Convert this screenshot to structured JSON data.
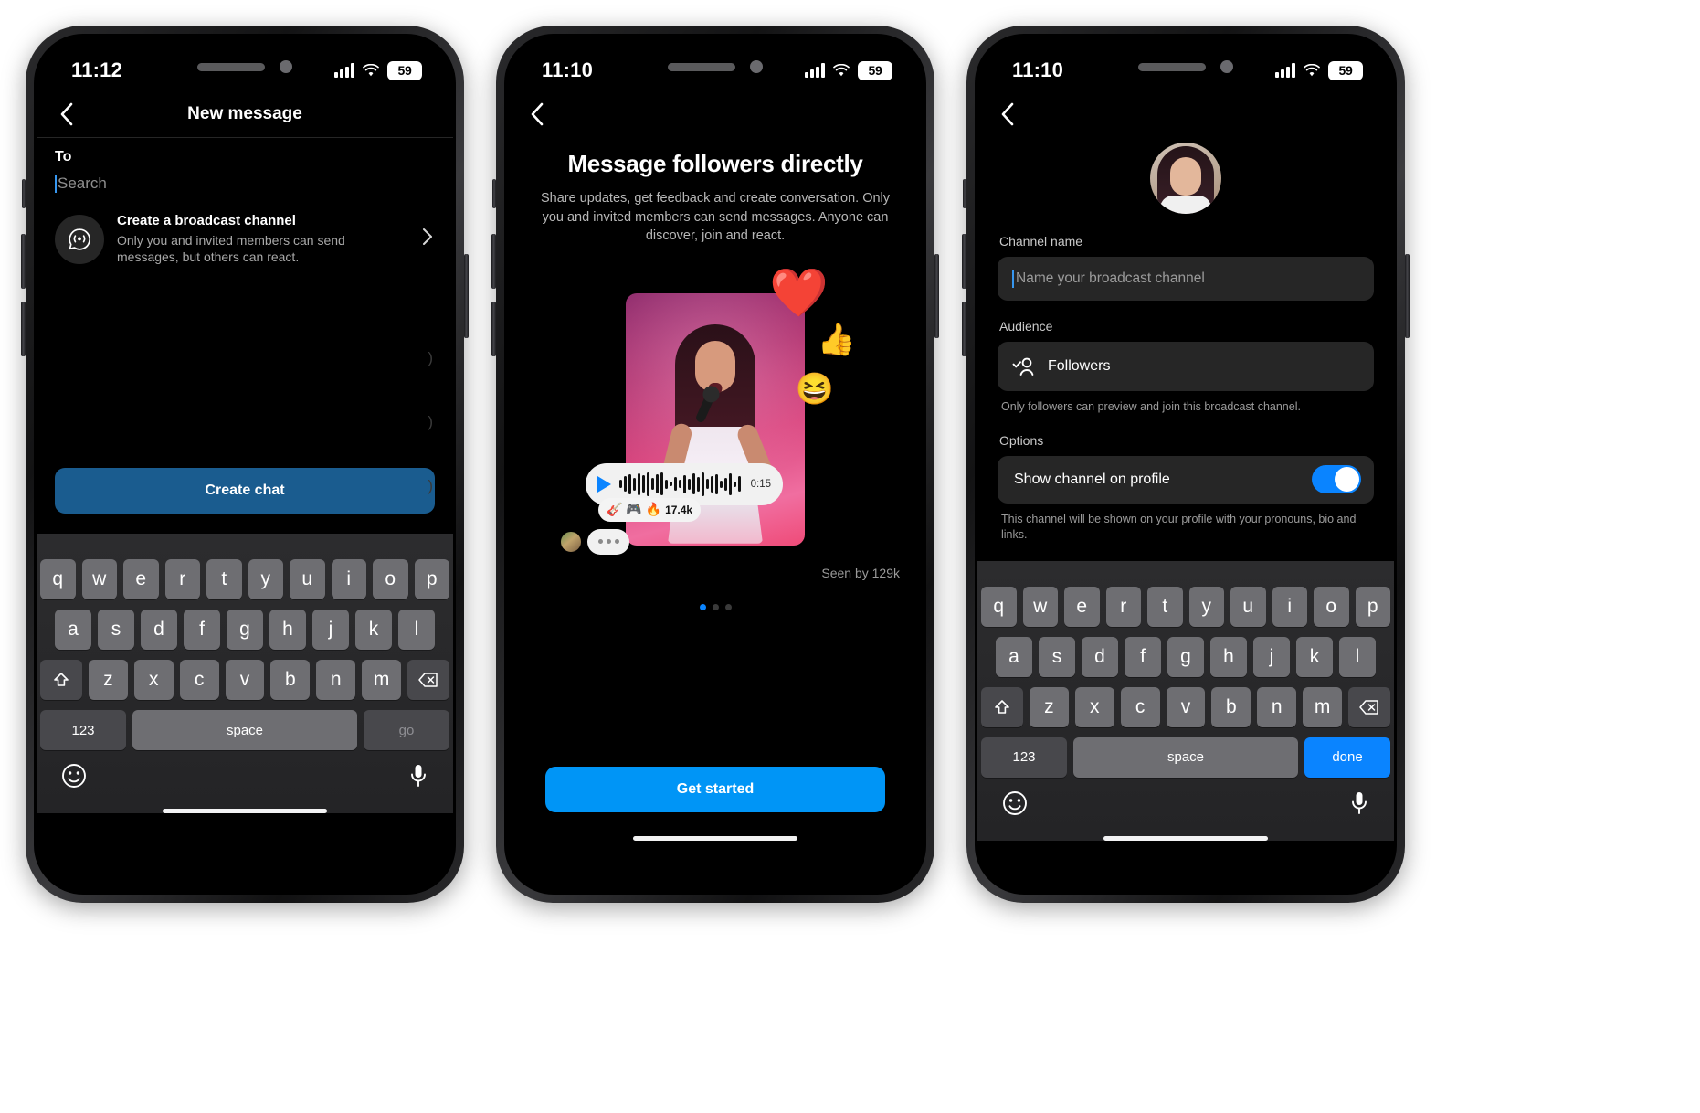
{
  "phones": [
    {
      "id": "new-message",
      "status": {
        "time": "11:12",
        "battery": "59"
      },
      "nav": {
        "title": "New message"
      },
      "to_label": "To",
      "search_placeholder": "Search",
      "broadcast": {
        "title": "Create a broadcast channel",
        "subtitle": "Only you and invited members can send messages, but others can react."
      },
      "cta": "Create chat",
      "keyboard": {
        "row1": [
          "q",
          "w",
          "e",
          "r",
          "t",
          "y",
          "u",
          "i",
          "o",
          "p"
        ],
        "row2": [
          "a",
          "s",
          "d",
          "f",
          "g",
          "h",
          "j",
          "k",
          "l"
        ],
        "row3": [
          "z",
          "x",
          "c",
          "v",
          "b",
          "n",
          "m"
        ],
        "num": "123",
        "space": "space",
        "action": "go"
      }
    },
    {
      "id": "message-followers-directly",
      "status": {
        "time": "11:10",
        "battery": "59"
      },
      "title": "Message followers directly",
      "subtitle": "Share updates, get feedback and create conversation. Only you and invited members can send messages. Anyone can discover, join and react.",
      "voice": {
        "duration": "0:15"
      },
      "reactions": {
        "emojis": "🎸 🎮 🔥",
        "count": "17.4k"
      },
      "floating_emojis": [
        "❤️",
        "👍",
        "😆"
      ],
      "seen_by": "Seen by 129k",
      "page_dots": {
        "total": 3,
        "active": 1
      },
      "cta": "Get started"
    },
    {
      "id": "create-broadcast-channel",
      "status": {
        "time": "11:10",
        "battery": "59"
      },
      "channel_name_label": "Channel name",
      "channel_name_placeholder": "Name your broadcast channel",
      "audience_label": "Audience",
      "audience_value": "Followers",
      "audience_hint": "Only followers can preview and join this broadcast channel.",
      "options_label": "Options",
      "option_toggle_label": "Show channel on profile",
      "option_toggle_on": true,
      "option_hint": "This channel will be shown on your profile with your pronouns, bio and links.",
      "keyboard": {
        "row1": [
          "q",
          "w",
          "e",
          "r",
          "t",
          "y",
          "u",
          "i",
          "o",
          "p"
        ],
        "row2": [
          "a",
          "s",
          "d",
          "f",
          "g",
          "h",
          "j",
          "k",
          "l"
        ],
        "row3": [
          "z",
          "x",
          "c",
          "v",
          "b",
          "n",
          "m"
        ],
        "num": "123",
        "space": "space",
        "action": "done"
      }
    }
  ],
  "colors": {
    "accent_blue": "#0095f6",
    "cta_muted_blue": "#1a5c8f",
    "toggle_on": "#0a84ff",
    "surface": "#262626",
    "background": "#000000"
  }
}
